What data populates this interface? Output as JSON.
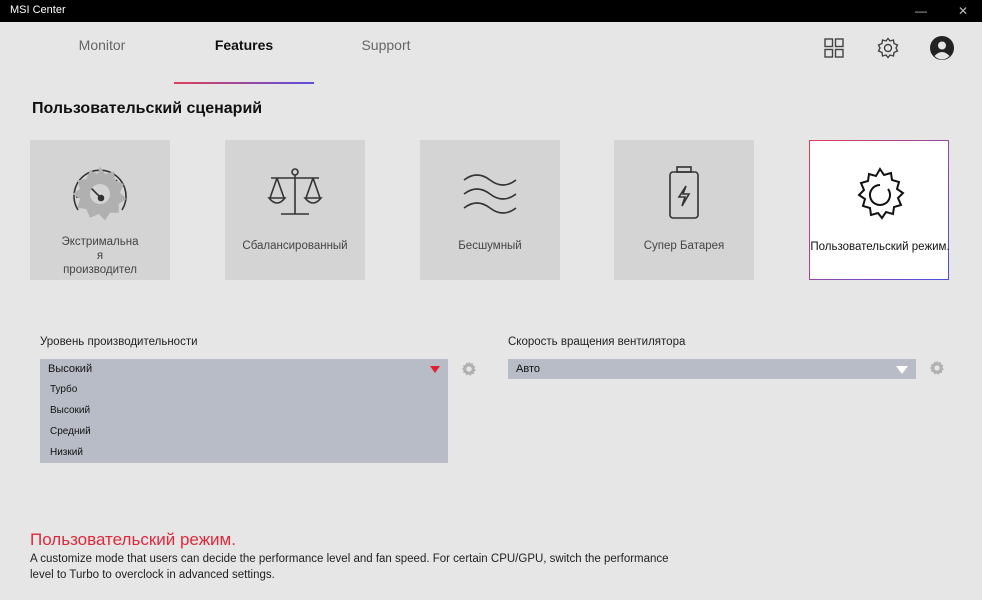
{
  "window": {
    "title": "MSI Center",
    "minimize": "—",
    "close": "✕"
  },
  "tabs": [
    {
      "label": "Monitor"
    },
    {
      "label": "Features"
    },
    {
      "label": "Support"
    }
  ],
  "header_icons": [
    "grid-icon",
    "gear-icon",
    "user-avatar-icon"
  ],
  "section": {
    "title": "Пользовательский сценарий"
  },
  "modes": [
    {
      "label_lines": [
        "Экстримальна",
        "я",
        "производител"
      ],
      "icon": "speedometer-icon"
    },
    {
      "label": "Сбалансированный",
      "icon": "balance-scale-icon"
    },
    {
      "label": "Бесшумный",
      "icon": "waves-icon"
    },
    {
      "label": "Супер Батарея",
      "icon": "battery-icon"
    },
    {
      "label": "Пользовательский режим.",
      "icon": "gear-icon",
      "selected": true
    }
  ],
  "performance": {
    "label": "Уровень производительности",
    "selected": "Высокий",
    "options": [
      "Турбо",
      "Высокий",
      "Средний",
      "Низкий"
    ]
  },
  "fan": {
    "label": "Скорость вращения вентилятора",
    "selected": "Авто"
  },
  "description": {
    "title": "Пользовательский режим.",
    "text": "A customize mode that users can decide the performance level and fan speed. For certain CPU/GPU, switch the performance level to Turbo to overclock in advanced settings."
  },
  "colors": {
    "accent_red": "#e0283c",
    "accent_blue": "#4b4ee8",
    "background": "#e6e6e6",
    "select_bg": "#b8bcc6"
  }
}
